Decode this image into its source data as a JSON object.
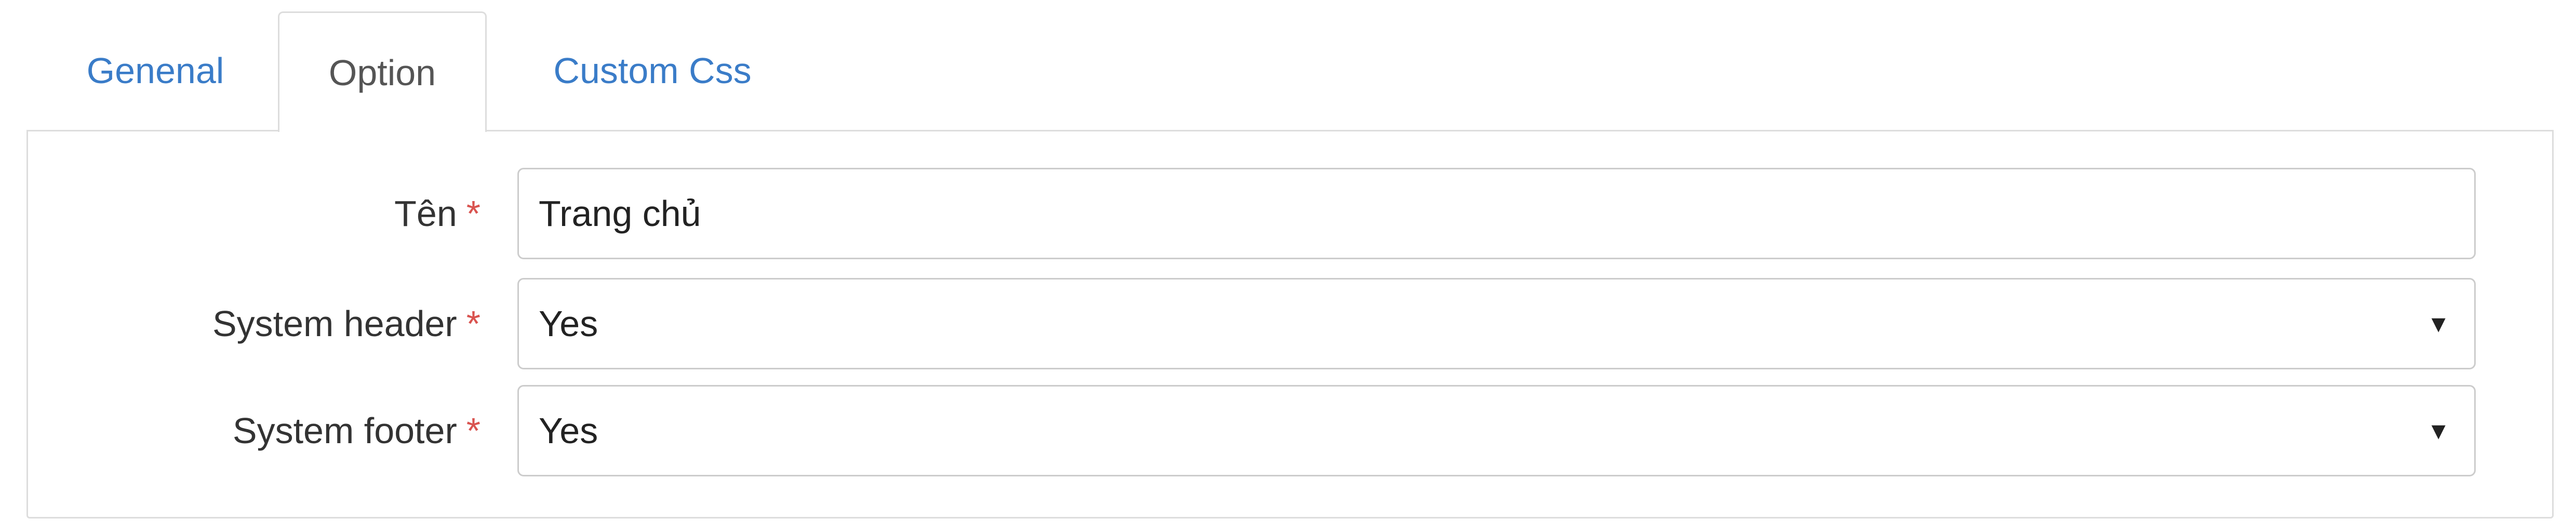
{
  "tabs": [
    {
      "label": "Genenal",
      "active": false
    },
    {
      "label": "Option",
      "active": true
    },
    {
      "label": "Custom Css",
      "active": false
    }
  ],
  "form": {
    "required_marker": "*",
    "name": {
      "label": "Tên",
      "value": "Trang chủ"
    },
    "system_header": {
      "label": "System header",
      "value": "Yes"
    },
    "system_footer": {
      "label": "System footer",
      "value": "Yes"
    }
  },
  "icons": {
    "select_caret": "caret-down-icon"
  },
  "colors": {
    "tab_link": "#3a7cc8",
    "tab_active_text": "#555555",
    "required": "#d9534f",
    "border": "#dddddd",
    "input_border": "#cccccc"
  }
}
